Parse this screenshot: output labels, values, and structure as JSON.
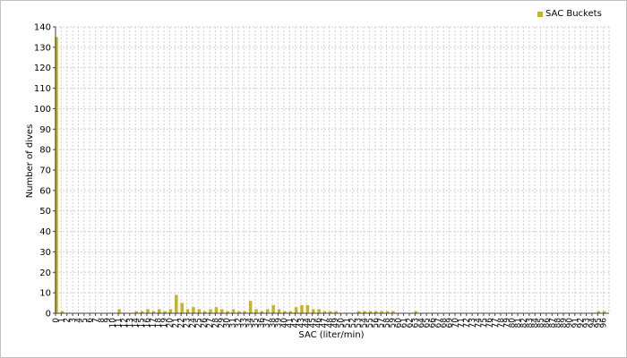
{
  "chart_data": {
    "type": "bar",
    "title": "",
    "xlabel": "SAC (liter/min)",
    "ylabel": "Number of dives",
    "ylim": [
      0,
      140
    ],
    "yticks": [
      0,
      10,
      20,
      30,
      40,
      50,
      60,
      70,
      80,
      90,
      100,
      110,
      120,
      130,
      140
    ],
    "grid": true,
    "legend": "top-right",
    "series": [
      {
        "name": "SAC Buckets",
        "color": "#c8b21e",
        "x": [
          0,
          1,
          11,
          14,
          15,
          16,
          17,
          18,
          19,
          20,
          21,
          22,
          23,
          24,
          25,
          26,
          27,
          28,
          29,
          30,
          31,
          32,
          33,
          34,
          35,
          36,
          37,
          38,
          39,
          40,
          41,
          42,
          43,
          44,
          45,
          46,
          47,
          48,
          49,
          53,
          54,
          55,
          56,
          57,
          58,
          59,
          63,
          95,
          96
        ],
        "values": [
          135,
          1,
          2,
          1,
          1,
          2,
          1,
          2,
          1,
          2,
          9,
          5,
          2,
          3,
          2,
          1,
          2,
          3,
          2,
          1,
          2,
          1,
          1,
          6,
          2,
          1,
          2,
          4,
          2,
          1,
          1,
          3,
          4,
          4,
          2,
          2,
          1,
          1,
          1,
          1,
          1,
          1,
          1,
          1,
          1,
          1,
          1,
          1,
          1
        ]
      }
    ],
    "xticks": [
      "0",
      "1",
      "2",
      "3",
      "4",
      "5",
      "6",
      "7",
      "8",
      "9",
      "10",
      "11",
      "12",
      "13",
      "14",
      "15",
      "16",
      "17",
      "18",
      "19",
      "20",
      "21",
      "22",
      "23",
      "24",
      "25",
      "26",
      "27",
      "28",
      "29",
      "30",
      "31",
      "32",
      "33",
      "34",
      "35",
      "36",
      "37",
      "38",
      "39",
      "40",
      "41",
      "42",
      "43",
      "44",
      "45",
      "46",
      "47",
      "48",
      "49",
      "50",
      "51",
      "52",
      "53",
      "54",
      "55",
      "56",
      "57",
      "58",
      "59",
      "60",
      "61",
      "62",
      "63",
      "64",
      "65",
      "66",
      "67",
      "68",
      "69",
      "70",
      "71",
      "72",
      "73",
      "74",
      "75",
      "76",
      "77",
      "78",
      "79",
      "80",
      "81",
      "82",
      "83",
      "84",
      "85",
      "86",
      "87",
      "88",
      "89",
      "90",
      "91",
      "92",
      "93",
      "94",
      "95",
      "96"
    ],
    "colors": {
      "grid": "#cfcfcf",
      "axis": "#404040",
      "bar": "#c8b21e",
      "background": "#ffffff"
    }
  }
}
